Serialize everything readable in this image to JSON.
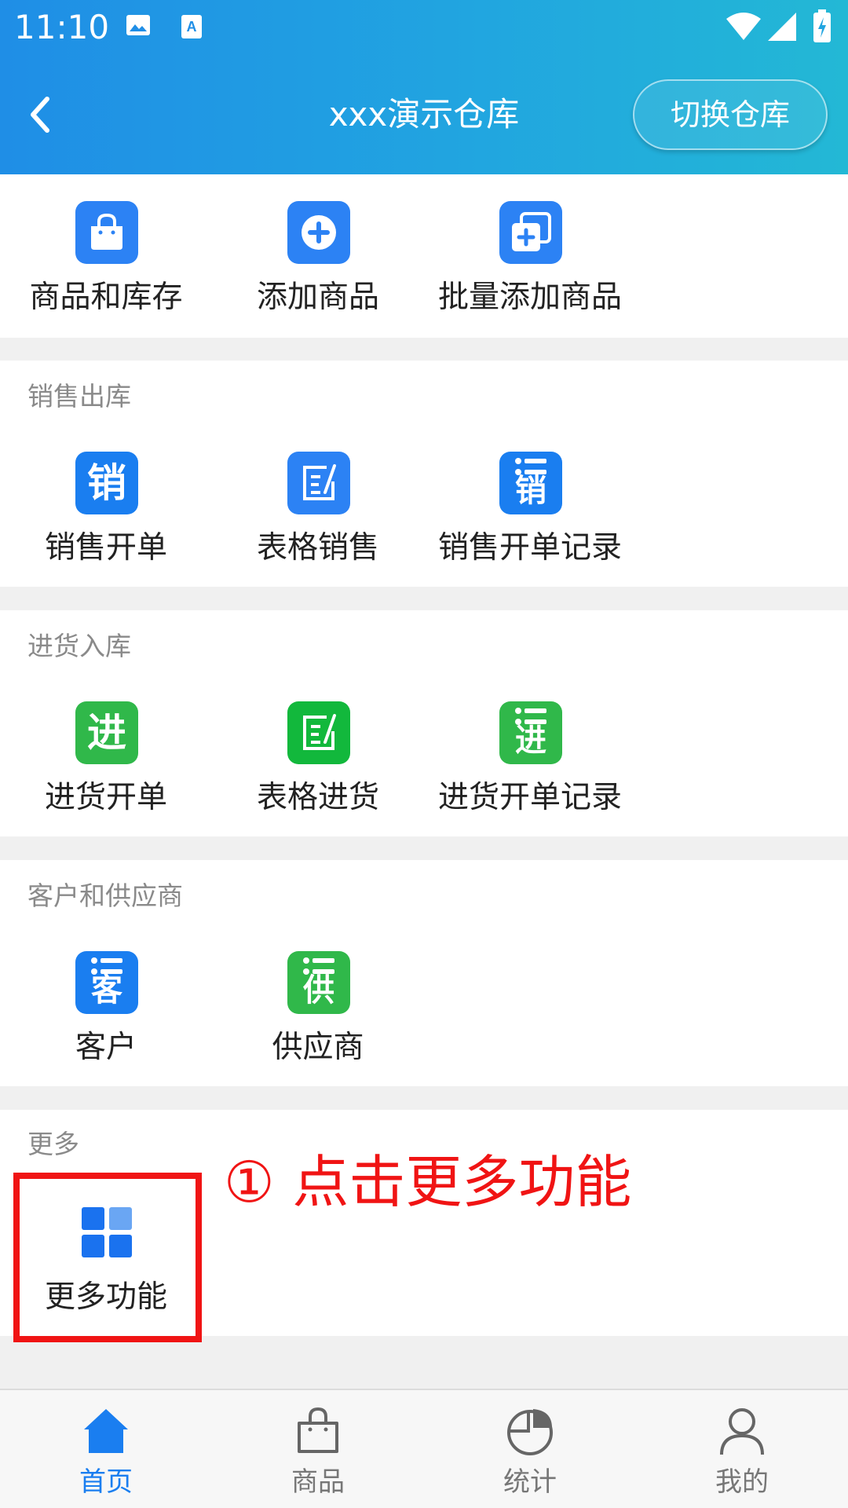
{
  "status_bar": {
    "time": "11:10"
  },
  "header": {
    "title": "xxx演示仓库",
    "switch_button": "切换仓库"
  },
  "quick_actions": [
    {
      "label": "商品和库存",
      "icon": "shopping-bag-icon"
    },
    {
      "label": "添加商品",
      "icon": "add-circle-icon"
    },
    {
      "label": "批量添加商品",
      "icon": "batch-add-icon"
    }
  ],
  "sections": [
    {
      "title": "销售出库",
      "items": [
        {
          "label": "销售开单",
          "icon": "sale-order-icon",
          "glyph": "销"
        },
        {
          "label": "表格销售",
          "icon": "table-edit-icon"
        },
        {
          "label": "销售开单记录",
          "icon": "sale-record-icon",
          "glyph": "销"
        }
      ]
    },
    {
      "title": "进货入库",
      "items": [
        {
          "label": "进货开单",
          "icon": "purchase-order-icon",
          "glyph": "进"
        },
        {
          "label": "表格进货",
          "icon": "table-edit-icon"
        },
        {
          "label": "进货开单记录",
          "icon": "purchase-record-icon",
          "glyph": "进"
        }
      ]
    },
    {
      "title": "客户和供应商",
      "items": [
        {
          "label": "客户",
          "icon": "customer-list-icon",
          "glyph": "客"
        },
        {
          "label": "供应商",
          "icon": "supplier-list-icon",
          "glyph": "供"
        }
      ]
    },
    {
      "title": "更多",
      "items": [
        {
          "label": "更多功能",
          "icon": "grid-apps-icon"
        }
      ]
    }
  ],
  "annotation": "① 点击更多功能",
  "tabs": [
    {
      "label": "首页",
      "icon": "home-icon",
      "active": true
    },
    {
      "label": "商品",
      "icon": "bag-icon",
      "active": false
    },
    {
      "label": "统计",
      "icon": "pie-chart-icon",
      "active": false
    },
    {
      "label": "我的",
      "icon": "user-icon",
      "active": false
    }
  ],
  "colors": {
    "primary": "#2c82f4",
    "green": "#30b84a",
    "accent_red": "#f01414",
    "tab_active": "#1a7ef0"
  }
}
